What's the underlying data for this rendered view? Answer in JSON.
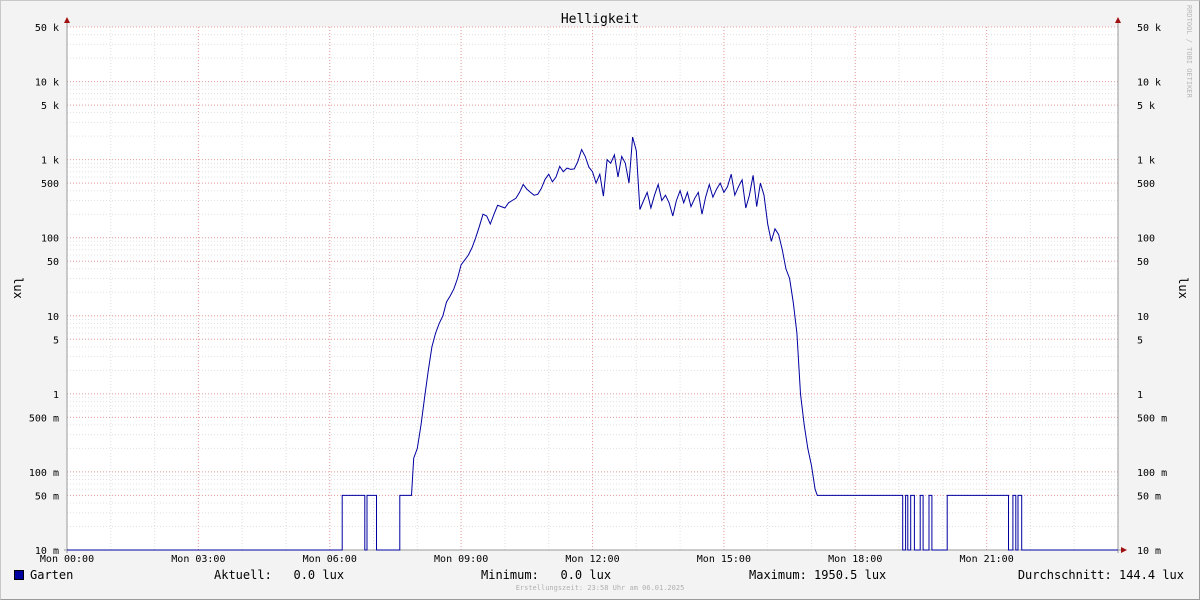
{
  "chart_data": {
    "type": "line",
    "title": "Helligkeit",
    "ylabel": "lux",
    "y_scale": "log",
    "ylim": [
      0.01,
      50000
    ],
    "xlim": [
      "Mon 00:00",
      "Tue 00:00"
    ],
    "grid": true,
    "y_ticks": [
      {
        "value": 0.01,
        "label": "10 m"
      },
      {
        "value": 0.05,
        "label": "50 m"
      },
      {
        "value": 0.1,
        "label": "100 m"
      },
      {
        "value": 0.5,
        "label": "500 m"
      },
      {
        "value": 1,
        "label": "1"
      },
      {
        "value": 5,
        "label": "5"
      },
      {
        "value": 10,
        "label": "10"
      },
      {
        "value": 50,
        "label": "50"
      },
      {
        "value": 100,
        "label": "100"
      },
      {
        "value": 500,
        "label": "500"
      },
      {
        "value": 1000,
        "label": "1 k"
      },
      {
        "value": 5000,
        "label": "5 k"
      },
      {
        "value": 10000,
        "label": "10 k"
      },
      {
        "value": 50000,
        "label": "50 k"
      }
    ],
    "x_ticks": [
      {
        "value": "00:00",
        "label": "Mon 00:00"
      },
      {
        "value": "03:00",
        "label": "Mon 03:00"
      },
      {
        "value": "06:00",
        "label": "Mon 06:00"
      },
      {
        "value": "09:00",
        "label": "Mon 09:00"
      },
      {
        "value": "12:00",
        "label": "Mon 12:00"
      },
      {
        "value": "15:00",
        "label": "Mon 15:00"
      },
      {
        "value": "18:00",
        "label": "Mon 18:00"
      },
      {
        "value": "21:00",
        "label": "Mon 21:00"
      }
    ],
    "series": [
      {
        "name": "Garten",
        "color": "#0000a0",
        "points": [
          [
            "00:00",
            0.01
          ],
          [
            "06:17",
            0.01
          ],
          [
            "06:17",
            0.05
          ],
          [
            "06:48",
            0.05
          ],
          [
            "06:48",
            0.01
          ],
          [
            "06:51",
            0.01
          ],
          [
            "06:51",
            0.05
          ],
          [
            "07:04",
            0.05
          ],
          [
            "07:04",
            0.01
          ],
          [
            "07:36",
            0.01
          ],
          [
            "07:36",
            0.05
          ],
          [
            "07:52",
            0.05
          ],
          [
            "07:55",
            0.15
          ],
          [
            "08:00",
            0.2
          ],
          [
            "08:05",
            0.4
          ],
          [
            "08:10",
            0.9
          ],
          [
            "08:15",
            2
          ],
          [
            "08:20",
            4
          ],
          [
            "08:25",
            6
          ],
          [
            "08:30",
            8
          ],
          [
            "08:35",
            10
          ],
          [
            "08:40",
            15
          ],
          [
            "08:45",
            18
          ],
          [
            "08:50",
            22
          ],
          [
            "08:55",
            30
          ],
          [
            "09:00",
            45
          ],
          [
            "09:05",
            52
          ],
          [
            "09:10",
            60
          ],
          [
            "09:15",
            75
          ],
          [
            "09:20",
            100
          ],
          [
            "09:25",
            140
          ],
          [
            "09:30",
            200
          ],
          [
            "09:35",
            190
          ],
          [
            "09:40",
            150
          ],
          [
            "09:45",
            200
          ],
          [
            "09:50",
            260
          ],
          [
            "09:55",
            250
          ],
          [
            "10:00",
            240
          ],
          [
            "10:05",
            280
          ],
          [
            "10:10",
            300
          ],
          [
            "10:15",
            320
          ],
          [
            "10:20",
            380
          ],
          [
            "10:25",
            480
          ],
          [
            "10:30",
            420
          ],
          [
            "10:35",
            380
          ],
          [
            "10:40",
            350
          ],
          [
            "10:45",
            360
          ],
          [
            "10:50",
            430
          ],
          [
            "10:55",
            560
          ],
          [
            "11:00",
            650
          ],
          [
            "11:05",
            520
          ],
          [
            "11:10",
            600
          ],
          [
            "11:15",
            820
          ],
          [
            "11:20",
            700
          ],
          [
            "11:25",
            780
          ],
          [
            "11:30",
            750
          ],
          [
            "11:35",
            760
          ],
          [
            "11:40",
            950
          ],
          [
            "11:45",
            1350
          ],
          [
            "11:50",
            1100
          ],
          [
            "11:55",
            800
          ],
          [
            "12:00",
            700
          ],
          [
            "12:05",
            500
          ],
          [
            "12:10",
            650
          ],
          [
            "12:15",
            340
          ],
          [
            "12:20",
            1000
          ],
          [
            "12:25",
            900
          ],
          [
            "12:30",
            1150
          ],
          [
            "12:35",
            600
          ],
          [
            "12:40",
            1100
          ],
          [
            "12:45",
            900
          ],
          [
            "12:50",
            500
          ],
          [
            "12:55",
            1950.5
          ],
          [
            "13:00",
            1300
          ],
          [
            "13:05",
            230
          ],
          [
            "13:10",
            300
          ],
          [
            "13:15",
            380
          ],
          [
            "13:20",
            240
          ],
          [
            "13:25",
            350
          ],
          [
            "13:30",
            480
          ],
          [
            "13:35",
            300
          ],
          [
            "13:40",
            350
          ],
          [
            "13:45",
            280
          ],
          [
            "13:50",
            190
          ],
          [
            "13:55",
            300
          ],
          [
            "14:00",
            400
          ],
          [
            "14:05",
            280
          ],
          [
            "14:10",
            380
          ],
          [
            "14:15",
            250
          ],
          [
            "14:20",
            320
          ],
          [
            "14:25",
            380
          ],
          [
            "14:30",
            200
          ],
          [
            "14:35",
            330
          ],
          [
            "14:40",
            480
          ],
          [
            "14:45",
            330
          ],
          [
            "14:50",
            420
          ],
          [
            "14:55",
            500
          ],
          [
            "15:00",
            380
          ],
          [
            "15:05",
            450
          ],
          [
            "15:10",
            650
          ],
          [
            "15:15",
            350
          ],
          [
            "15:20",
            450
          ],
          [
            "15:25",
            550
          ],
          [
            "15:30",
            240
          ],
          [
            "15:35",
            350
          ],
          [
            "15:40",
            630
          ],
          [
            "15:45",
            250
          ],
          [
            "15:50",
            500
          ],
          [
            "15:55",
            350
          ],
          [
            "16:00",
            150
          ],
          [
            "16:05",
            90
          ],
          [
            "16:10",
            130
          ],
          [
            "16:15",
            110
          ],
          [
            "16:20",
            70
          ],
          [
            "16:25",
            40
          ],
          [
            "16:30",
            30
          ],
          [
            "16:35",
            15
          ],
          [
            "16:40",
            6
          ],
          [
            "16:45",
            1
          ],
          [
            "16:50",
            0.4
          ],
          [
            "16:55",
            0.2
          ],
          [
            "17:00",
            0.12
          ],
          [
            "17:05",
            0.06
          ],
          [
            "17:08",
            0.05
          ],
          [
            "19:05",
            0.05
          ],
          [
            "19:05",
            0.01
          ],
          [
            "19:09",
            0.01
          ],
          [
            "19:09",
            0.05
          ],
          [
            "19:12",
            0.05
          ],
          [
            "19:12",
            0.01
          ],
          [
            "19:16",
            0.01
          ],
          [
            "19:16",
            0.05
          ],
          [
            "19:21",
            0.05
          ],
          [
            "19:21",
            0.01
          ],
          [
            "19:29",
            0.01
          ],
          [
            "19:29",
            0.05
          ],
          [
            "19:33",
            0.05
          ],
          [
            "19:33",
            0.01
          ],
          [
            "19:41",
            0.01
          ],
          [
            "19:41",
            0.05
          ],
          [
            "19:45",
            0.05
          ],
          [
            "19:45",
            0.01
          ],
          [
            "20:06",
            0.01
          ],
          [
            "20:06",
            0.05
          ],
          [
            "21:30",
            0.05
          ],
          [
            "21:30",
            0.01
          ],
          [
            "21:36",
            0.01
          ],
          [
            "21:36",
            0.05
          ],
          [
            "21:40",
            0.05
          ],
          [
            "21:40",
            0.01
          ],
          [
            "21:43",
            0.01
          ],
          [
            "21:43",
            0.05
          ],
          [
            "21:48",
            0.05
          ],
          [
            "21:48",
            0.01
          ],
          [
            "24:00",
            0.01
          ]
        ]
      }
    ]
  },
  "legend": {
    "series_name": "Garten",
    "current": "Aktuell:   0.0 lux",
    "minimum": "Minimum:   0.0 lux",
    "maximum": "Maximum: 1950.5 lux",
    "average": "Durchschnitt: 144.4 lux"
  },
  "watermark": "RRDTOOL / TOBI OETIKER",
  "footer": "Erstellungszeit: 23:58 Uhr am 06.01.2025"
}
